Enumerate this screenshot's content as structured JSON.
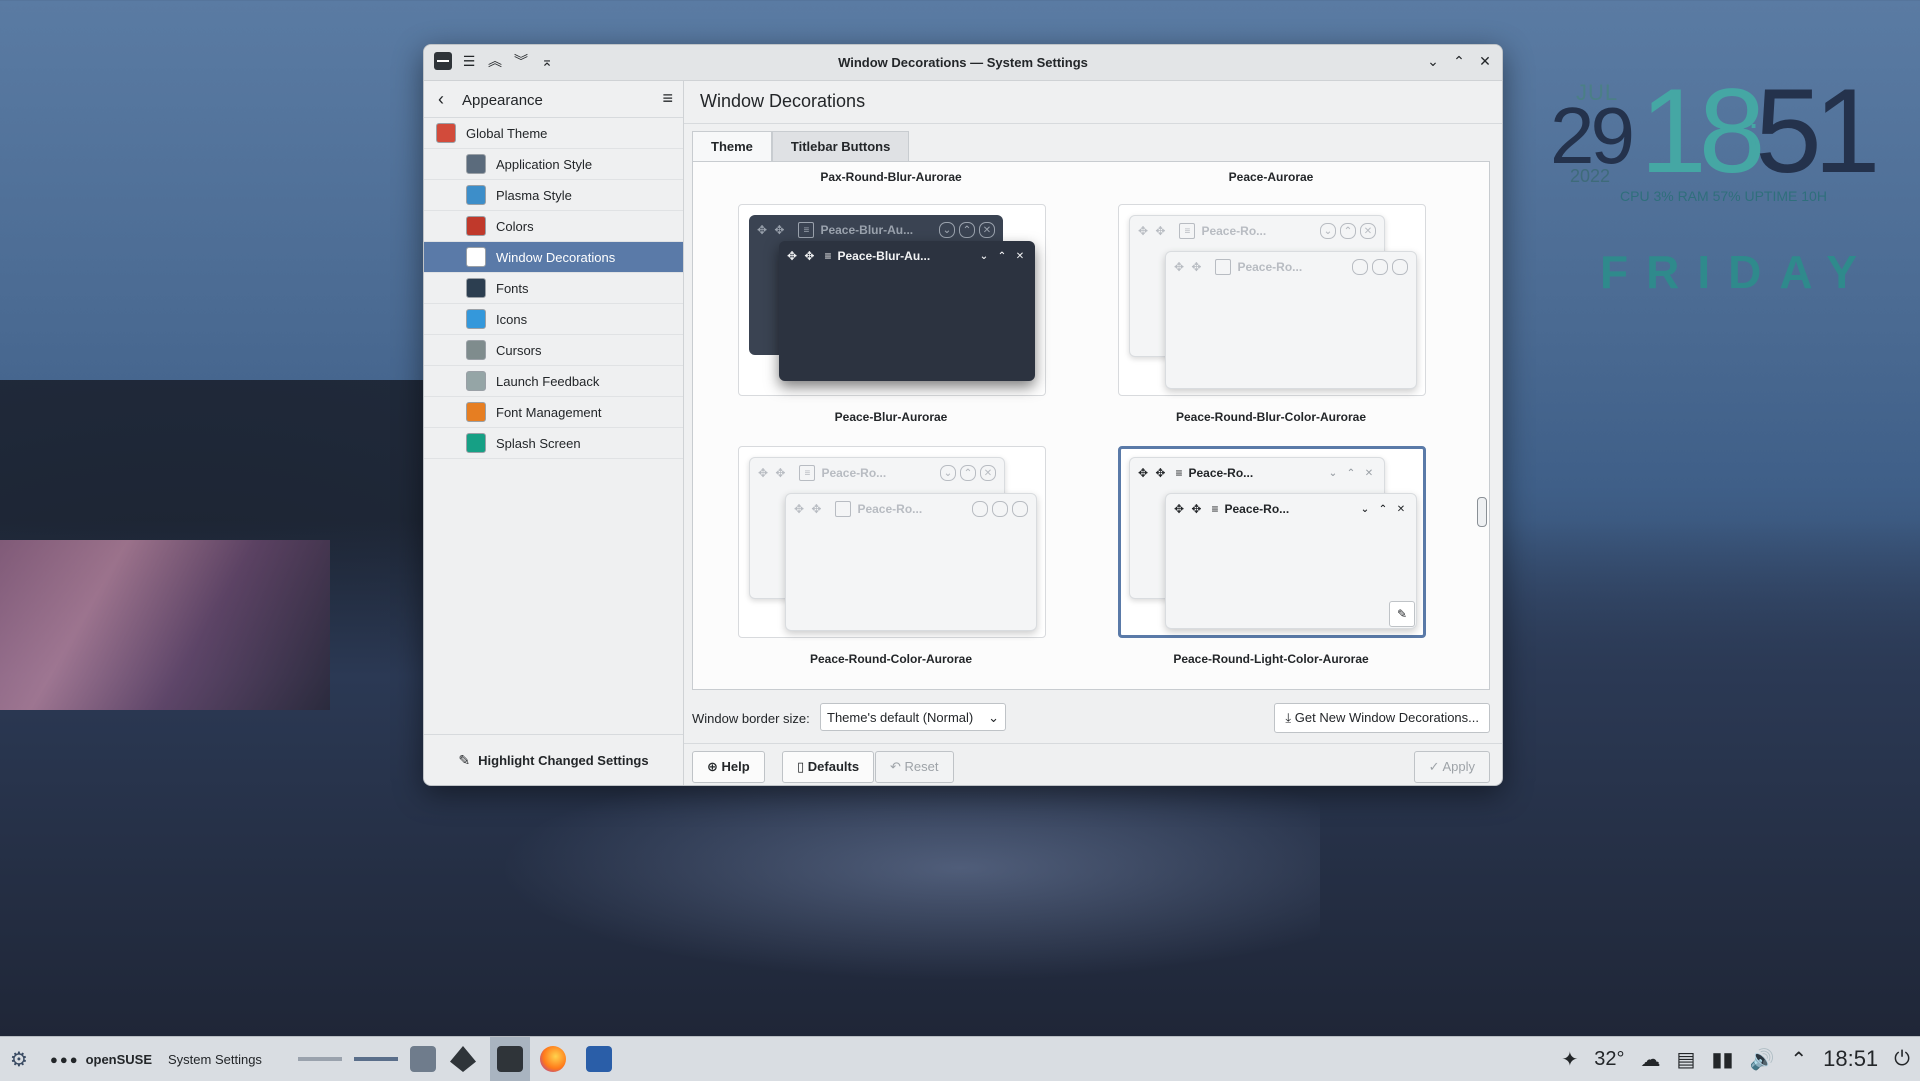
{
  "window": {
    "title": "Window Decorations — System Settings",
    "titlebar_icons": [
      "menu-icon",
      "keep-above-icon",
      "keep-below-icon",
      "shade-icon"
    ],
    "controls": [
      "minimize-icon",
      "maximize-icon",
      "close-icon"
    ]
  },
  "sidebar": {
    "back_label": "Appearance",
    "items": [
      {
        "label": "Global Theme",
        "level": "top",
        "icon": "global-theme-icon",
        "color": "#d24b3b"
      },
      {
        "label": "Application Style",
        "level": "sub",
        "icon": "application-style-icon",
        "color": "#5b6b7c"
      },
      {
        "label": "Plasma Style",
        "level": "sub",
        "icon": "plasma-style-icon",
        "color": "#3d8ec9"
      },
      {
        "label": "Colors",
        "level": "sub",
        "icon": "colors-icon",
        "color": "#c0392b"
      },
      {
        "label": "Window Decorations",
        "level": "sub",
        "icon": "window-decorations-icon",
        "color": "#ffffff",
        "active": true
      },
      {
        "label": "Fonts",
        "level": "sub",
        "icon": "fonts-icon",
        "color": "#2c3e50"
      },
      {
        "label": "Icons",
        "level": "sub",
        "icon": "icons-icon",
        "color": "#3498db"
      },
      {
        "label": "Cursors",
        "level": "sub",
        "icon": "cursors-icon",
        "color": "#7f8c8d"
      },
      {
        "label": "Launch Feedback",
        "level": "sub",
        "icon": "launch-feedback-icon",
        "color": "#95a5a6"
      },
      {
        "label": "Font Management",
        "level": "sub",
        "icon": "font-management-icon",
        "color": "#e67e22"
      },
      {
        "label": "Splash Screen",
        "level": "sub",
        "icon": "splash-screen-icon",
        "color": "#16a085"
      }
    ],
    "highlight_label": "Highlight Changed Settings"
  },
  "main": {
    "title": "Window Decorations",
    "tabs": [
      {
        "label": "Theme",
        "active": true
      },
      {
        "label": "Titlebar Buttons",
        "active": false
      }
    ],
    "partial_names": [
      "Pax-Round-Blur-Aurorae",
      "Peace-Aurorae"
    ],
    "decorations": [
      {
        "name": "Peace-Blur-Aurorae",
        "style": "dark",
        "title1": "Peace-Blur-Au...",
        "title2": "Peace-Blur-Au..."
      },
      {
        "name": "Peace-Round-Blur-Color-Aurorae",
        "style": "light",
        "title1": "Peace-Ro...",
        "title2": "Peace-Ro..."
      },
      {
        "name": "Peace-Round-Color-Aurorae",
        "style": "light",
        "title1": "Peace-Ro...",
        "title2": "Peace-Ro..."
      },
      {
        "name": "Peace-Round-Light-Color-Aurorae",
        "style": "light-strong",
        "selected": true,
        "title1": "Peace-Ro...",
        "title2": "Peace-Ro..."
      }
    ],
    "border_size_label": "Window border size:",
    "border_size_value": "Theme's default (Normal)",
    "get_new_label": "Get New Window Decorations...",
    "buttons": {
      "help": "Help",
      "defaults": "Defaults",
      "reset": "Reset",
      "apply": "Apply"
    }
  },
  "clock": {
    "month": "JUL",
    "day": "29",
    "year": "2022",
    "hour": "18",
    "minute": "51",
    "stats": "CPU 3% RAM 57% UPTIME 10H",
    "weekday": "FRIDAY"
  },
  "taskbar": {
    "distro": "openSUSE",
    "active_app": "System Settings",
    "temperature": "32°",
    "time": "18:51"
  }
}
